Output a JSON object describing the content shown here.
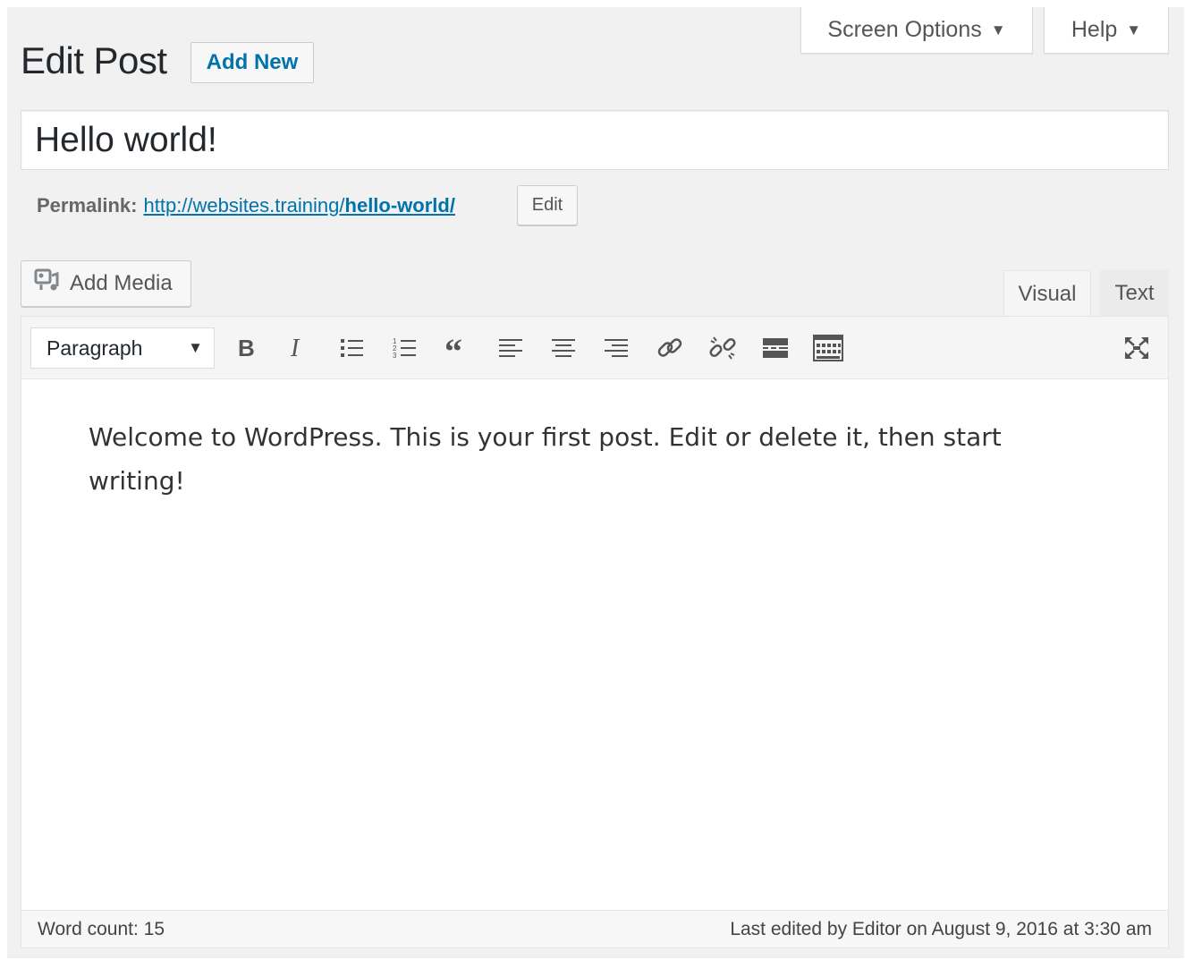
{
  "meta_tabs": {
    "screen_options": "Screen Options",
    "help": "Help"
  },
  "header": {
    "title": "Edit Post",
    "add_new": "Add New"
  },
  "post": {
    "title": "Hello world!",
    "permalink_label": "Permalink:",
    "permalink_base": "http://websites.training/",
    "permalink_slug": "hello-world/",
    "edit_label": "Edit"
  },
  "editor": {
    "add_media": "Add Media",
    "tabs": {
      "visual": "Visual",
      "text": "Text"
    },
    "active_tab": "Visual",
    "format_select": "Paragraph",
    "toolbar_icons": [
      "bold-icon",
      "italic-icon",
      "bulleted-list-icon",
      "numbered-list-icon",
      "blockquote-icon",
      "align-left-icon",
      "align-center-icon",
      "align-right-icon",
      "link-icon",
      "unlink-icon",
      "read-more-icon",
      "toolbar-toggle-icon",
      "fullscreen-icon"
    ],
    "content": "Welcome to WordPress. This is your first post. Edit or delete it, then start writing!"
  },
  "status": {
    "word_count": "Word count: 15",
    "last_edited": "Last edited by Editor on August 9, 2016 at 3:30 am"
  },
  "colors": {
    "link": "#0073aa",
    "background": "#f1f1f1"
  }
}
